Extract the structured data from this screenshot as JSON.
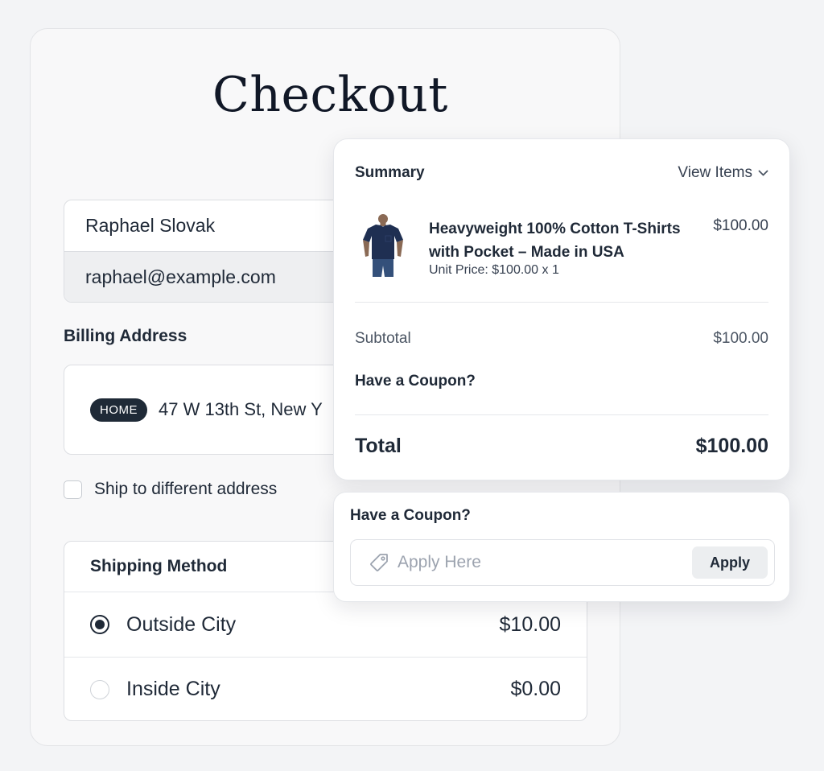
{
  "checkout": {
    "title": "Checkout",
    "contact": {
      "name": "Raphael Slovak",
      "email": "raphael@example.com"
    },
    "billing": {
      "label": "Billing Address",
      "badge": "HOME",
      "address": "47 W 13th St, New Y"
    },
    "ship_different": {
      "label": "Ship to different address",
      "checked": false
    },
    "shipping": {
      "label": "Shipping Method",
      "options": [
        {
          "label": "Outside City",
          "price": "$10.00",
          "selected": true
        },
        {
          "label": "Inside City",
          "price": "$0.00",
          "selected": false
        }
      ]
    }
  },
  "summary": {
    "title": "Summary",
    "view_items": "View Items",
    "item": {
      "name": "Heavyweight 100% Cotton T-Shirts with Pocket – Made in USA",
      "unit_price": "Unit Price: $100.00  x 1",
      "price": "$100.00",
      "image_icon": "navy-t-shirt-icon"
    },
    "subtotal_label": "Subtotal",
    "subtotal_value": "$100.00",
    "coupon_link": "Have a Coupon?",
    "total_label": "Total",
    "total_value": "$100.00"
  },
  "coupon": {
    "title": "Have a Coupon?",
    "placeholder": "Apply Here",
    "value": "",
    "apply_label": "Apply"
  },
  "colors": {
    "page_background": "#f3f4f6",
    "badge_background": "#1f2a37",
    "text_primary": "#1f2937",
    "placeholder": "#9ca3af"
  }
}
